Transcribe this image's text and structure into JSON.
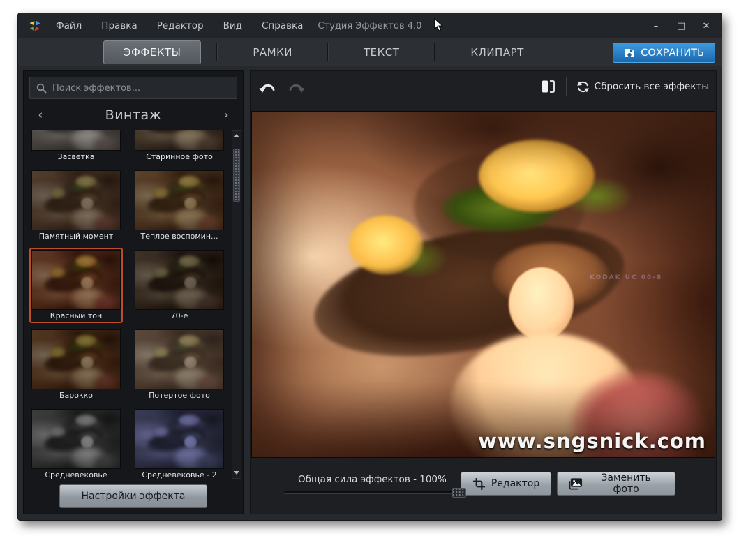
{
  "window": {
    "title": "Студия Эффектов 4.0",
    "minimize": "–",
    "maximize": "□",
    "close": "✕"
  },
  "menu": {
    "items": [
      {
        "label": "Файл"
      },
      {
        "label": "Правка"
      },
      {
        "label": "Редактор"
      },
      {
        "label": "Вид"
      },
      {
        "label": "Справка"
      }
    ]
  },
  "tabs": {
    "items": [
      {
        "label": "ЭФФЕКТЫ",
        "active": true
      },
      {
        "label": "РАМКИ",
        "active": false
      },
      {
        "label": "ТЕКСТ",
        "active": false
      },
      {
        "label": "КЛИПАРТ",
        "active": false
      }
    ],
    "save_label": "СОХРАНИТЬ"
  },
  "effects_panel": {
    "search_placeholder": "Поиск эффектов...",
    "category": {
      "prev": "‹",
      "name": "Винтаж",
      "next": "›"
    },
    "items": [
      {
        "label": "Засветка",
        "fx": "fx-zasvetka",
        "selected": false
      },
      {
        "label": "Старинное фото",
        "fx": "fx-old",
        "selected": false
      },
      {
        "label": "Памятный момент",
        "fx": "fx-memory",
        "selected": false
      },
      {
        "label": "Теплое воспомин...",
        "fx": "fx-warm",
        "selected": false
      },
      {
        "label": "Красный тон",
        "fx": "fx-red",
        "selected": true
      },
      {
        "label": "70-е",
        "fx": "fx-70s",
        "selected": false
      },
      {
        "label": "Барокко",
        "fx": "fx-baroque",
        "selected": false
      },
      {
        "label": "Потертое фото",
        "fx": "fx-worn",
        "selected": false
      },
      {
        "label": "Средневековье",
        "fx": "fx-medieval",
        "selected": false
      },
      {
        "label": "Средневековье - 2",
        "fx": "fx-medieval2",
        "selected": false
      }
    ],
    "settings_button": "Настройки эффекта"
  },
  "editor": {
    "reset_label": "Сбросить все эффекты",
    "strength_label": "Общая сила эффектов - 100%",
    "editor_button": "Редактор",
    "replace_button": "Заменить фото",
    "watermark": "www.sngsnick.com",
    "photo_marking": "KODAK UC 00-8",
    "current_effect_fx": "fx-red"
  },
  "colors": {
    "accent_blue": "#1e72b8",
    "selection_orange": "#bc4f2a"
  }
}
